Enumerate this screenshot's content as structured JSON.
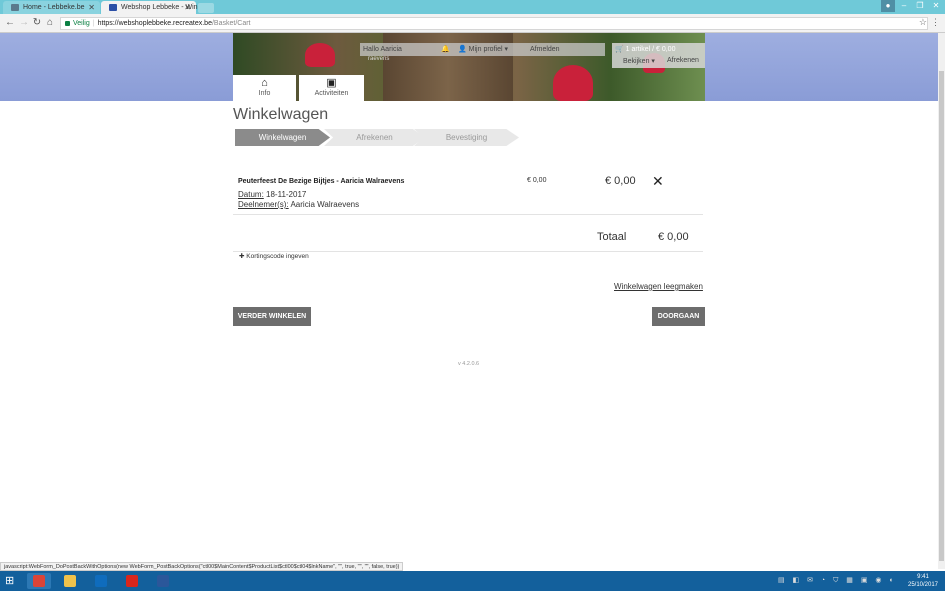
{
  "browser": {
    "tabs": [
      {
        "title": "Home - Lebbeke.be"
      },
      {
        "title": "Webshop Lebbeke - Win"
      }
    ],
    "address": {
      "secure_label": "Veilig",
      "host": "https://webshoplebbeke.recreatex.be",
      "path": "/Basket/Cart"
    }
  },
  "header": {
    "greeting": "Hallo Aaricia",
    "profile": "Mijn profiel ▾",
    "logout": "Afmelden",
    "username_fragment": "raevens",
    "cart_summary": "🛒 1 artikel / € 0,00",
    "cart_view": "Bekijken ▾",
    "cart_checkout": "Afrekenen",
    "nav": [
      {
        "label": "Info",
        "icon": "home-icon"
      },
      {
        "label": "Activiteiten",
        "icon": "calendar-icon"
      }
    ]
  },
  "page": {
    "title": "Winkelwagen",
    "steps": [
      "Winkelwagen",
      "Afrekenen",
      "Bevestiging"
    ],
    "item": {
      "name": "Peuterfeest De Bezige Bijtjes - Aaricia Walraevens",
      "price": "€ 0,00",
      "total": "€ 0,00",
      "date_label": "Datum:",
      "date": " 18-11-2017",
      "participants_label": "Deelnemer(s):",
      "participants": " Aaricia Walraevens"
    },
    "total_label": "Totaal",
    "total_value": "€ 0,00",
    "discount_link": "✚ Kortingscode ingeven",
    "clear_cart": "Winkelwagen leegmaken",
    "continue_shopping": "VERDER WINKELEN",
    "proceed": "DOORGAAN",
    "version": "v 4.2.0.6"
  },
  "status_bar": "javascript:WebForm_DoPostBackWithOptions(new WebForm_PostBackOptions(\"ctl00$MainContent$ProductList$ctl00$ctl04$lnkName\", \"\", true, \"\", \"\", false, true))",
  "taskbar": {
    "time": "9:41",
    "date": "25/10/2017"
  },
  "colors": {
    "accent": "#6fc9d8",
    "header_bg": "#9eaee0",
    "button": "#6d6d6d",
    "taskbar": "#13609c"
  }
}
